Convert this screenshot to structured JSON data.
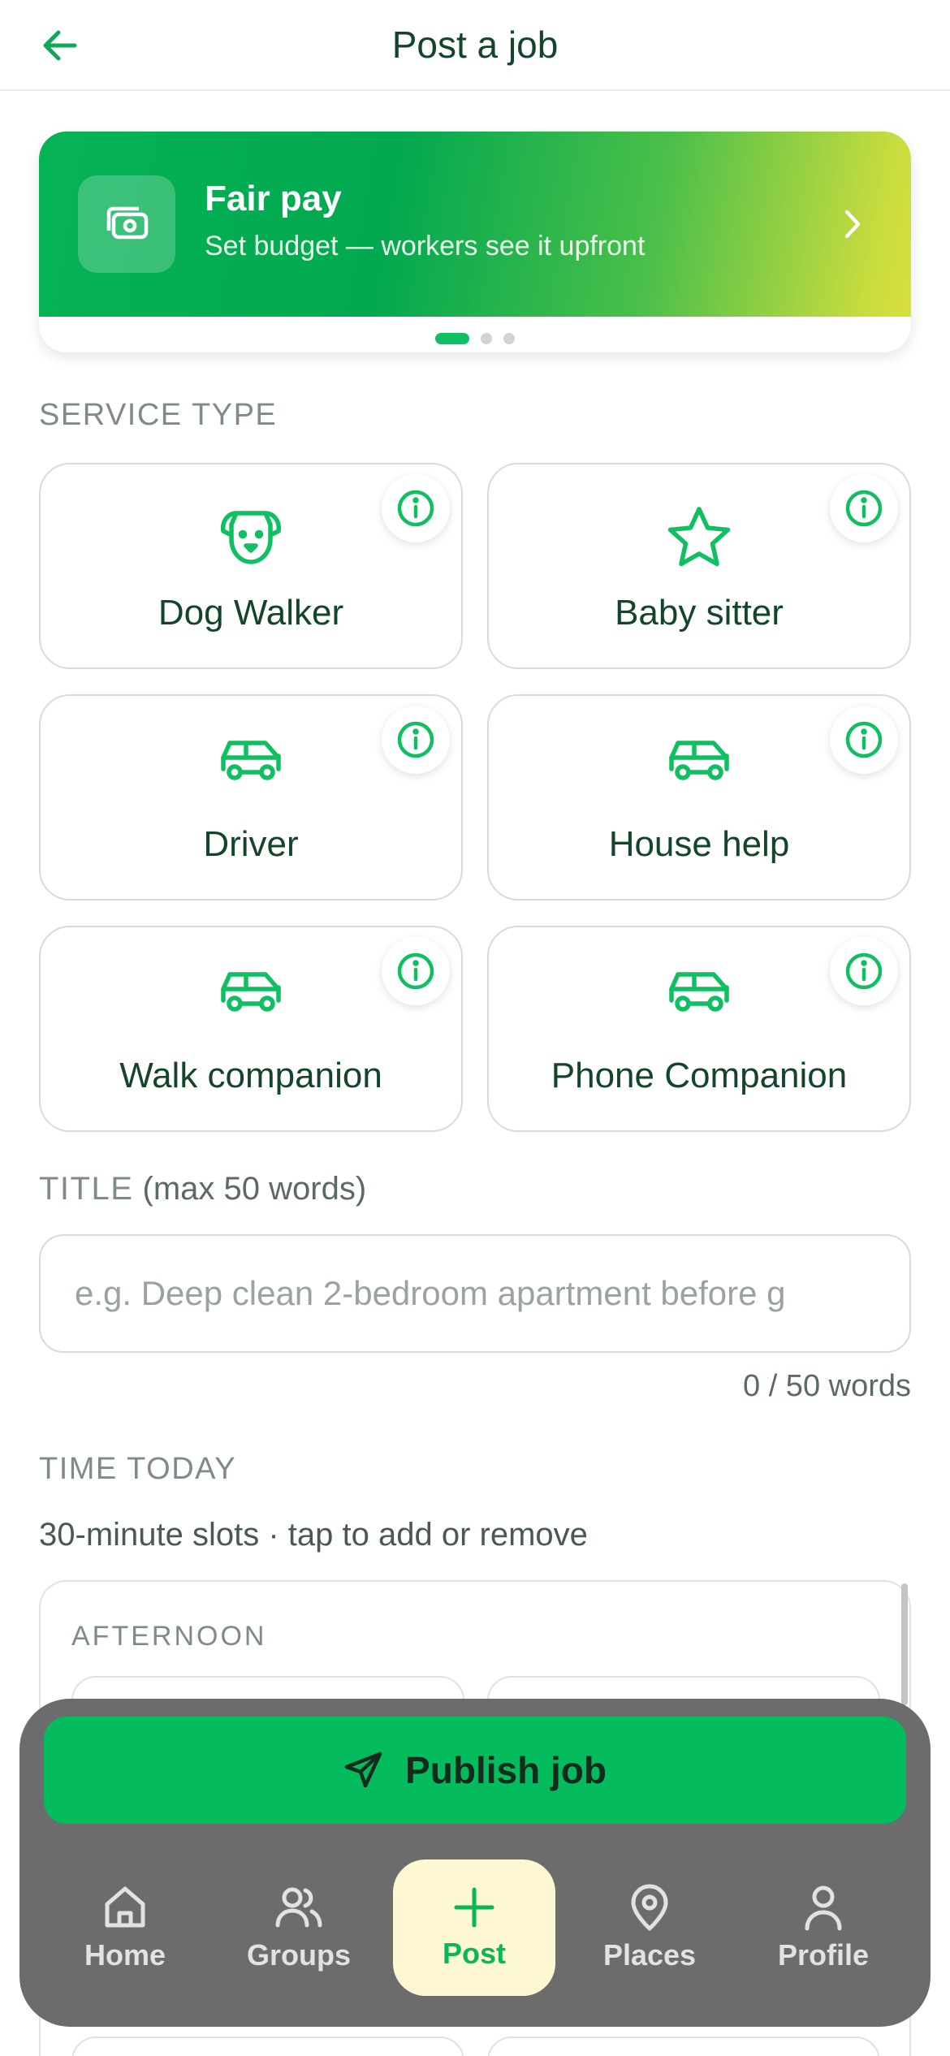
{
  "header": {
    "title": "Post a job"
  },
  "banner": {
    "title": "Fair pay",
    "subtitle": "Set budget — workers see it upfront"
  },
  "service_section": {
    "label": "SERVICE TYPE"
  },
  "services": [
    {
      "label": "Dog Walker",
      "icon": "dog-icon"
    },
    {
      "label": "Baby sitter",
      "icon": "star-icon"
    },
    {
      "label": "Driver",
      "icon": "car-icon"
    },
    {
      "label": "House help",
      "icon": "car-icon"
    },
    {
      "label": "Walk companion",
      "icon": "car-icon"
    },
    {
      "label": "Phone Companion",
      "icon": "car-icon"
    }
  ],
  "title_field": {
    "label": "TITLE",
    "label_hint": "(max 50 words)",
    "placeholder": "e.g. Deep clean 2-bedroom apartment before g",
    "value": "",
    "counter": "0 / 50 words"
  },
  "time_section": {
    "label": "TIME TODAY",
    "subtitle": "30-minute slots · tap to add or remove",
    "group_title": "AFTERNOON"
  },
  "publish": {
    "label": "Publish job"
  },
  "nav": {
    "items": [
      {
        "label": "Home",
        "icon": "home-icon"
      },
      {
        "label": "Groups",
        "icon": "groups-icon"
      },
      {
        "label": "Post",
        "icon": "plus-icon",
        "active": true
      },
      {
        "label": "Places",
        "icon": "map-pin-icon"
      },
      {
        "label": "Profile",
        "icon": "user-icon"
      }
    ]
  },
  "colors": {
    "brand_green": "#04bc5e",
    "icon_green": "#0fbf61",
    "text_dark": "#14452a",
    "nav_active_bg": "#fef8d2"
  }
}
